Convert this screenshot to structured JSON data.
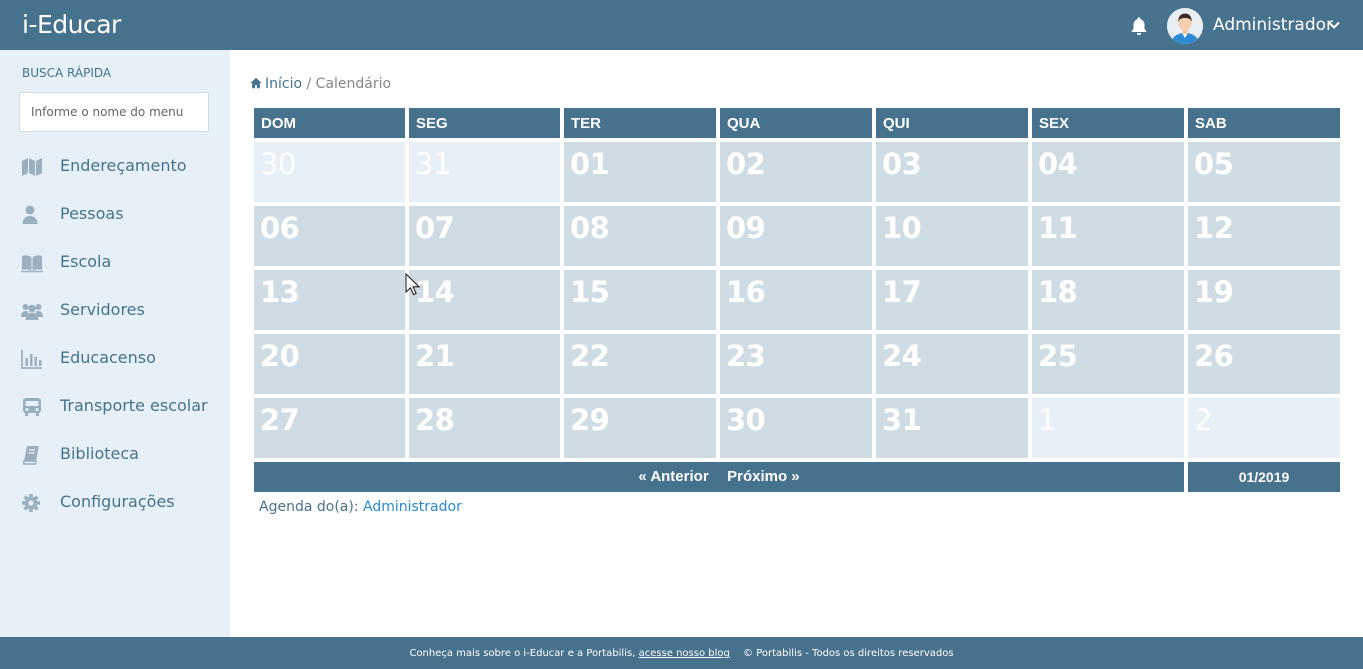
{
  "app": {
    "logo": "i-Educar",
    "user_name": "Administrador"
  },
  "sidebar": {
    "quick_search_title": "BUSCA RÁPIDA",
    "quick_search_placeholder": "Informe o nome do menu",
    "items": [
      {
        "label": "Endereçamento",
        "icon": "map-icon"
      },
      {
        "label": "Pessoas",
        "icon": "user-icon"
      },
      {
        "label": "Escola",
        "icon": "book-open-icon"
      },
      {
        "label": "Servidores",
        "icon": "users-icon"
      },
      {
        "label": "Educacenso",
        "icon": "bar-chart-icon"
      },
      {
        "label": "Transporte escolar",
        "icon": "bus-icon"
      },
      {
        "label": "Biblioteca",
        "icon": "book-icon"
      },
      {
        "label": "Configurações",
        "icon": "gear-icon"
      }
    ]
  },
  "breadcrumb": {
    "home": "Início",
    "separator": "/",
    "current": "Calendário"
  },
  "calendar": {
    "weekdays": [
      "DOM",
      "SEG",
      "TER",
      "QUA",
      "QUI",
      "SEX",
      "SAB"
    ],
    "weeks": [
      [
        {
          "d": "30",
          "other": true
        },
        {
          "d": "31",
          "other": true
        },
        {
          "d": "01"
        },
        {
          "d": "02"
        },
        {
          "d": "03"
        },
        {
          "d": "04"
        },
        {
          "d": "05"
        }
      ],
      [
        {
          "d": "06"
        },
        {
          "d": "07"
        },
        {
          "d": "08"
        },
        {
          "d": "09"
        },
        {
          "d": "10"
        },
        {
          "d": "11"
        },
        {
          "d": "12"
        }
      ],
      [
        {
          "d": "13"
        },
        {
          "d": "14"
        },
        {
          "d": "15"
        },
        {
          "d": "16"
        },
        {
          "d": "17"
        },
        {
          "d": "18"
        },
        {
          "d": "19"
        }
      ],
      [
        {
          "d": "20"
        },
        {
          "d": "21"
        },
        {
          "d": "22"
        },
        {
          "d": "23"
        },
        {
          "d": "24"
        },
        {
          "d": "25"
        },
        {
          "d": "26"
        }
      ],
      [
        {
          "d": "27"
        },
        {
          "d": "28"
        },
        {
          "d": "29"
        },
        {
          "d": "30"
        },
        {
          "d": "31"
        },
        {
          "d": "1",
          "other": true
        },
        {
          "d": "2",
          "other": true
        }
      ]
    ],
    "prev_label": "« Anterior",
    "next_label": "Próximo »",
    "month": "01/2019"
  },
  "agenda": {
    "label": "Agenda do(a):",
    "user": "Administrador"
  },
  "footer": {
    "text": "Conheça mais sobre o i-Educar e a Portabilis,",
    "link": "acesse nosso blog",
    "copyright": "© Portabilis - Todos os direitos reservados"
  },
  "colors": {
    "primary": "#47728e",
    "sidebar_bg": "#e8f0f7",
    "cell_bg": "#cfdce3",
    "link": "#2a8ad4"
  }
}
